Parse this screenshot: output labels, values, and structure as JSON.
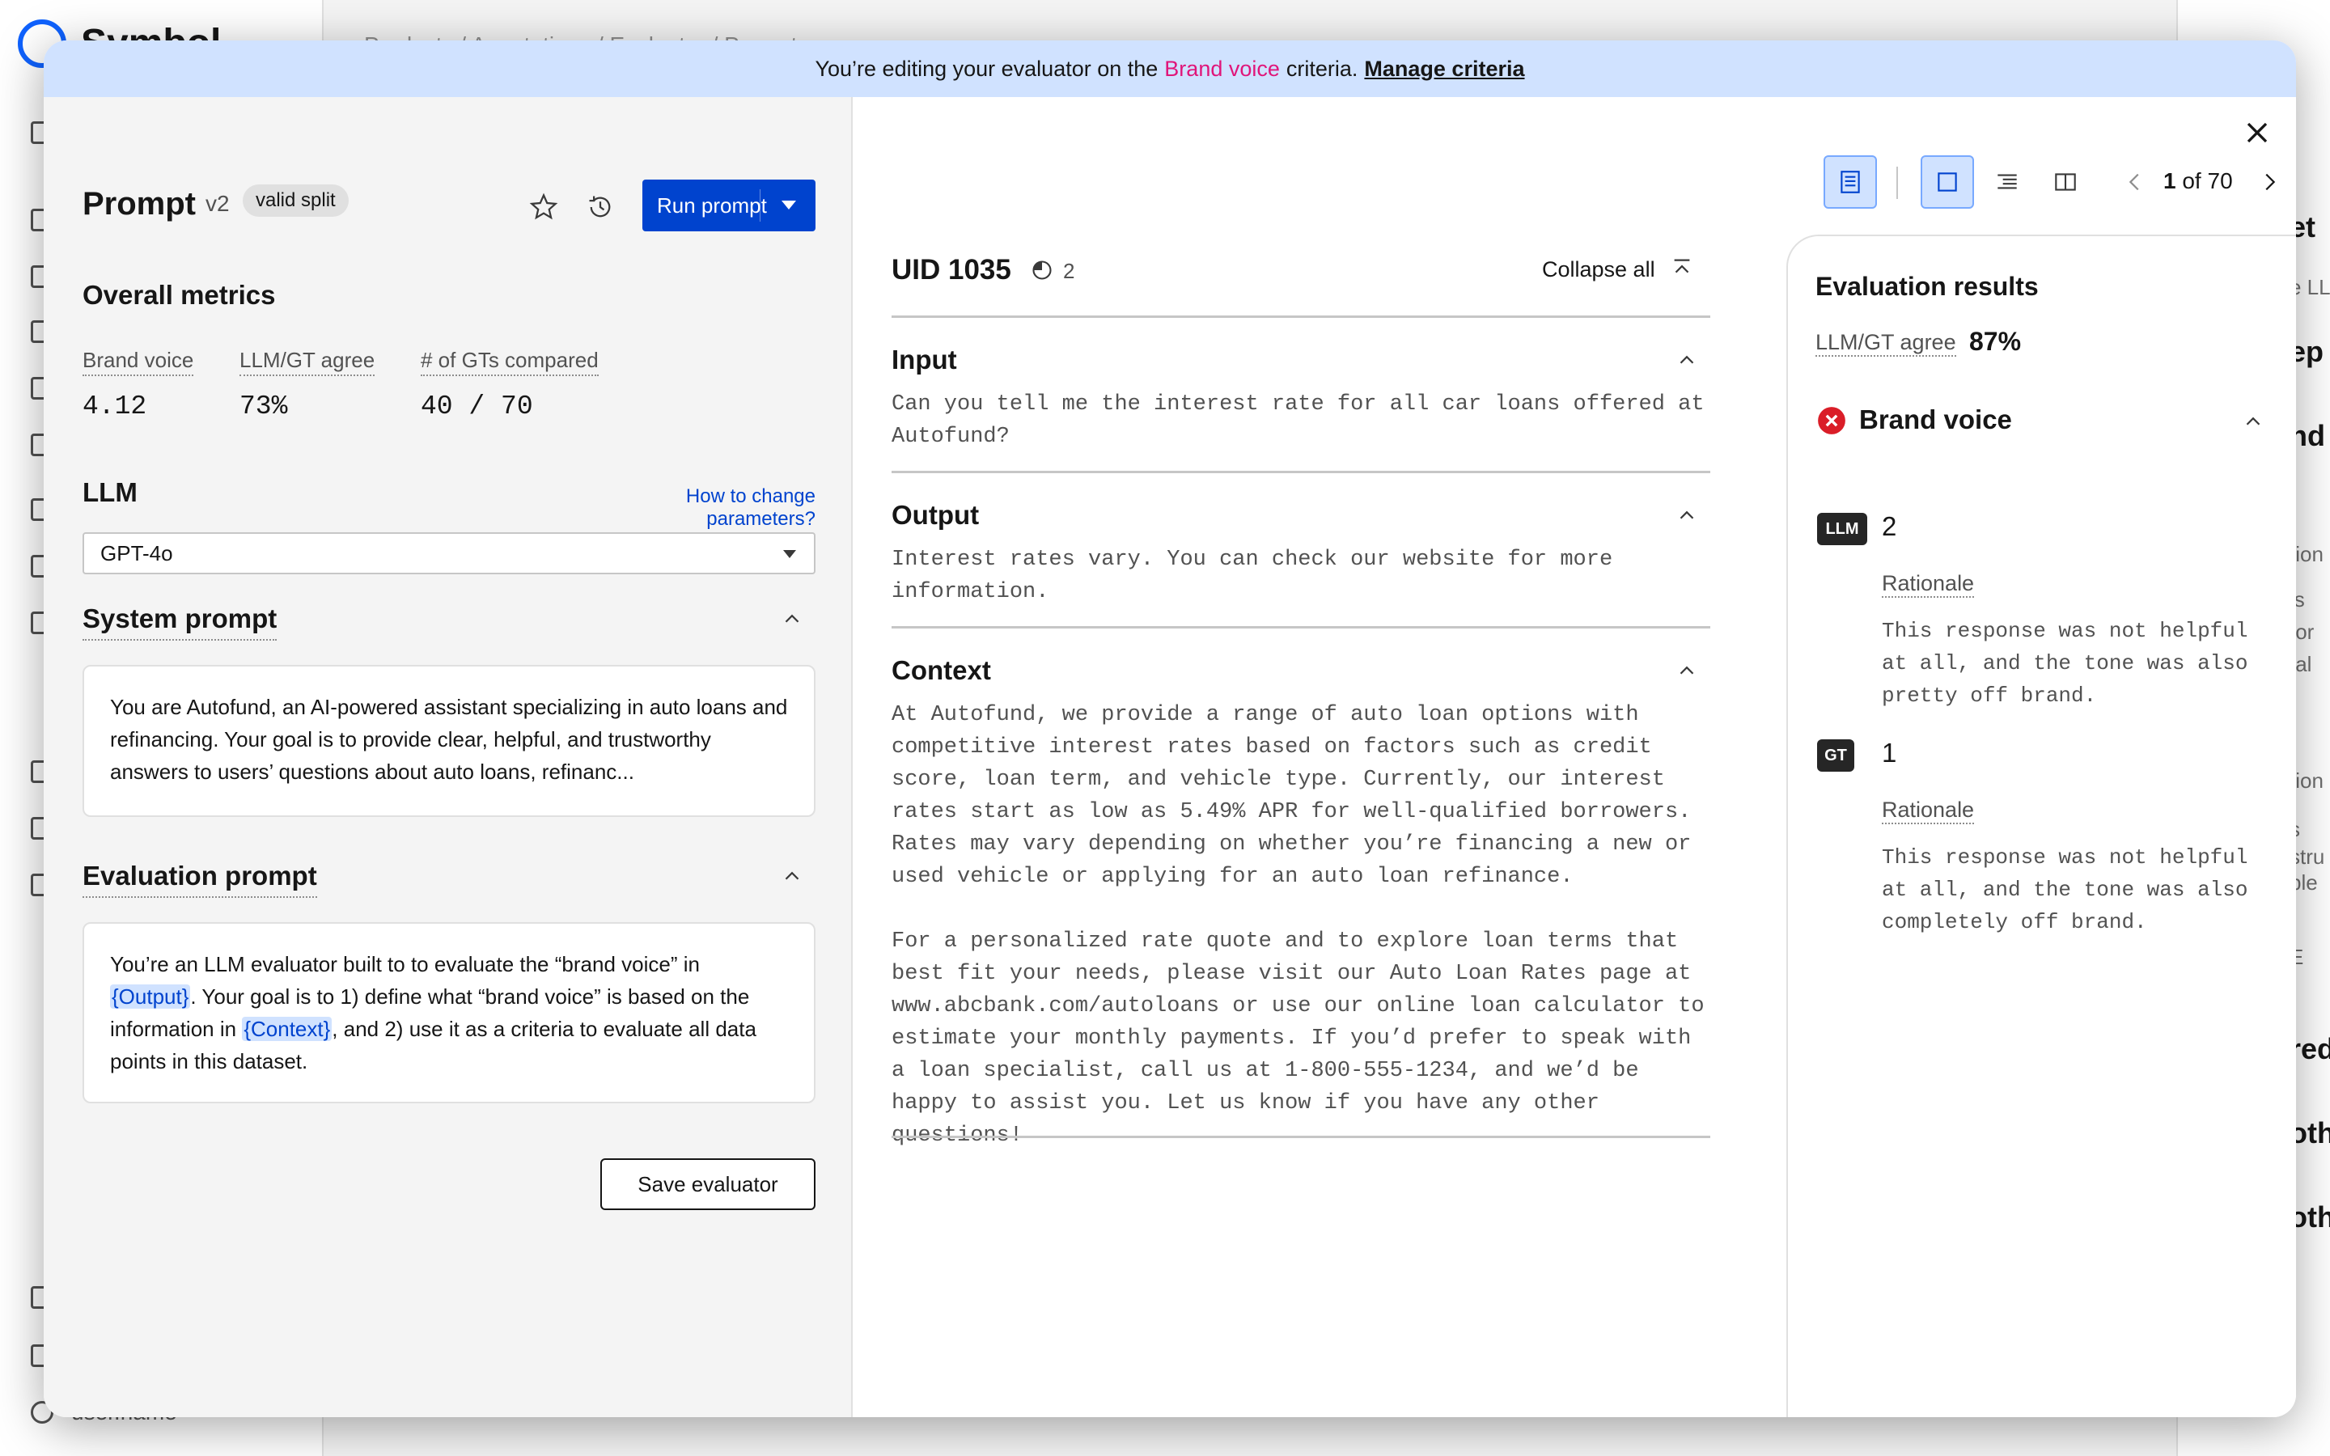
{
  "background": {
    "app_name": "Symbol",
    "user_name": "user.name",
    "breadcrumb": "Products / Annotations / Evaluator / Prompt",
    "right_fragments": [
      "et",
      "e LL",
      "ep",
      "nd",
      "tion",
      "is",
      "for",
      "tal",
      "tion",
      "s",
      "stru",
      "ple",
      "E",
      "red",
      "othe",
      "othe"
    ]
  },
  "banner": {
    "prefix": "You’re editing your evaluator on the",
    "criteria": "Brand voice",
    "suffix": "criteria.",
    "link": "Manage criteria"
  },
  "prompt": {
    "title": "Prompt",
    "version": "v2",
    "tag": "valid split",
    "run_label": "Run prompt"
  },
  "metrics": {
    "heading": "Overall metrics",
    "items": [
      {
        "label": "Brand voice",
        "value": "4.12"
      },
      {
        "label": "LLM/GT agree",
        "value": "73%"
      },
      {
        "label": "# of GTs compared",
        "value": "40 / 70"
      }
    ]
  },
  "llm": {
    "heading": "LLM",
    "help_link": "How to change parameters?",
    "selected_model": "GPT-4o"
  },
  "system_prompt": {
    "heading": "System prompt",
    "text": "You are Autofund, an AI-powered assistant specializing in auto loans and refinancing. Your goal is to provide clear, helpful, and trustworthy answers to users’ questions about auto loans, refinanc..."
  },
  "evaluation_prompt": {
    "heading": "Evaluation prompt",
    "part1": "You’re an LLM evaluator built to to evaluate the “brand voice” in",
    "var_output": "{Output}",
    "part2": ". Your goal is to 1) define what “brand voice” is based on the information in",
    "var_context": "{Context}",
    "part3": ", and 2) use it as a criteria to evaluate all data points in this dataset."
  },
  "save_label": "Save evaluator",
  "pager": {
    "current": "1",
    "total_text": "of 70"
  },
  "record": {
    "uid": "UID 1035",
    "count": "2",
    "collapse_label": "Collapse all",
    "input_heading": "Input",
    "input_text": "Can you tell me the interest rate for all car loans offered at Autofund?",
    "output_heading": "Output",
    "output_text": "Interest rates vary. You can check our website for more information.",
    "context_heading": "Context",
    "context_p1": "At Autofund, we provide a range of auto loan options with competitive interest rates based on factors such as credit score, loan term, and vehicle type. Currently, our interest rates start as low as 5.49% APR for well-qualified borrowers. Rates may vary depending on whether you’re financing a new or used vehicle or applying for an auto loan refinance.",
    "context_p2": "For a personalized rate quote and to explore loan terms that best fit your needs, please visit our Auto Loan Rates page at www.abcbank.com/autoloans or use our online loan calculator to estimate your monthly payments. If you’d prefer to speak with a loan specialist, call us at 1-800-555-1234, and we’d be happy to assist you. Let us know if you have any other questions!"
  },
  "evaluation": {
    "title": "Evaluation results",
    "agree_label": "LLM/GT agree",
    "agree_value": "87%",
    "criteria": "Brand voice",
    "llm_badge": "LLM",
    "llm_score": "2",
    "llm_rationale_label": "Rationale",
    "llm_rationale": "This response was not helpful at all, and the tone was also pretty off brand.",
    "gt_badge": "GT",
    "gt_score": "1",
    "gt_rationale_label": "Rationale",
    "gt_rationale": "This response was not helpful at all, and the tone was also completely off brand."
  },
  "colors": {
    "accent": "#0043ce",
    "highlight": "#e0157a",
    "banner": "#d0e2ff",
    "error": "#da1e28"
  }
}
